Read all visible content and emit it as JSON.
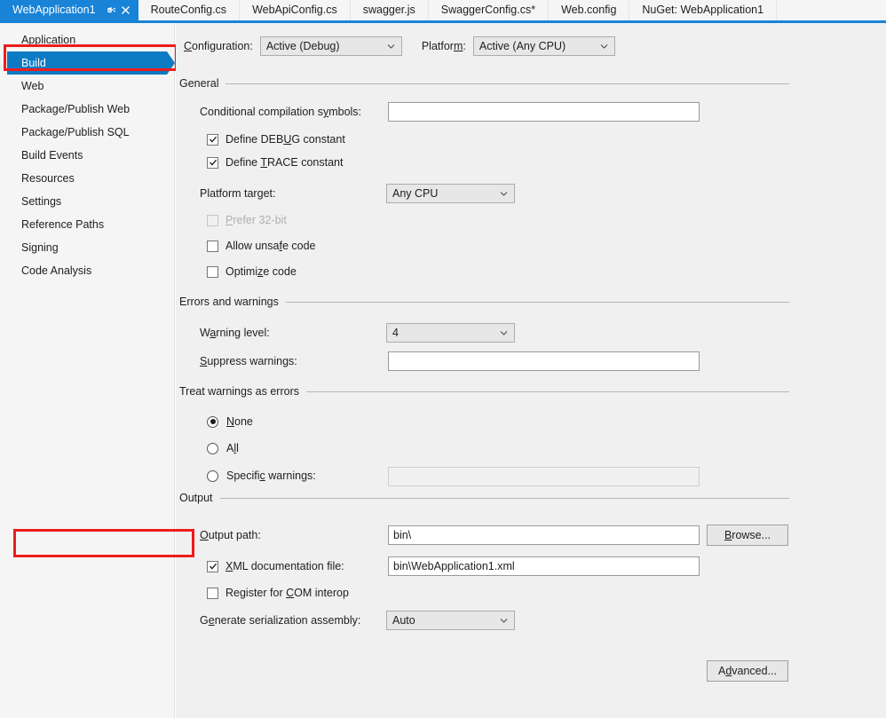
{
  "tabs": [
    {
      "label": "WebApplication1",
      "active": true,
      "pin_icon": "pin-icon",
      "close_icon": "close-icon"
    },
    {
      "label": "RouteConfig.cs",
      "active": false
    },
    {
      "label": "WebApiConfig.cs",
      "active": false
    },
    {
      "label": "swagger.js",
      "active": false
    },
    {
      "label": "SwaggerConfig.cs*",
      "active": false
    },
    {
      "label": "Web.config",
      "active": false
    },
    {
      "label": "NuGet: WebApplication1",
      "active": false
    }
  ],
  "sidebar": {
    "items": [
      {
        "label": "Application",
        "selected": false
      },
      {
        "label": "Build",
        "selected": true
      },
      {
        "label": "Web",
        "selected": false
      },
      {
        "label": "Package/Publish Web",
        "selected": false
      },
      {
        "label": "Package/Publish SQL",
        "selected": false
      },
      {
        "label": "Build Events",
        "selected": false
      },
      {
        "label": "Resources",
        "selected": false
      },
      {
        "label": "Settings",
        "selected": false
      },
      {
        "label": "Reference Paths",
        "selected": false
      },
      {
        "label": "Signing",
        "selected": false
      },
      {
        "label": "Code Analysis",
        "selected": false
      }
    ]
  },
  "config_row": {
    "configuration_label_pre": "C",
    "configuration_label_post": "onfiguration:",
    "configuration_value": "Active (Debug)",
    "platform_label_pre": "Platfor",
    "platform_label_mn": "m",
    "platform_label_post": ":",
    "platform_value": "Active (Any CPU)"
  },
  "general": {
    "title": "General",
    "cond_symbols_label_pre": "Conditional compilation s",
    "cond_symbols_label_mn": "y",
    "cond_symbols_label_post": "mbols:",
    "cond_symbols_value": "",
    "define_debug_pre": "Define DEB",
    "define_debug_mn": "U",
    "define_debug_post": "G constant",
    "define_debug_checked": true,
    "define_trace_pre": "Define ",
    "define_trace_mn": "T",
    "define_trace_post": "RACE constant",
    "define_trace_checked": true,
    "platform_target_label_pre": "Platform tar",
    "platform_target_label_mn": "g",
    "platform_target_label_post": "et:",
    "platform_target_value": "Any CPU",
    "prefer32_pre": "",
    "prefer32_mn": "P",
    "prefer32_post": "refer 32-bit",
    "prefer32_checked": false,
    "prefer32_disabled": true,
    "unsafe_pre": "Allow unsa",
    "unsafe_mn": "f",
    "unsafe_post": "e code",
    "unsafe_checked": false,
    "optimize_pre": "Optimi",
    "optimize_mn": "z",
    "optimize_post": "e code",
    "optimize_checked": false
  },
  "errors_warnings": {
    "title": "Errors and warnings",
    "warning_level_label_pre": "W",
    "warning_level_label_mn": "a",
    "warning_level_label_post": "rning level:",
    "warning_level_value": "4",
    "suppress_label_pre": "",
    "suppress_label_mn": "S",
    "suppress_label_post": "uppress warnings:",
    "suppress_value": ""
  },
  "treat_warnings": {
    "title": "Treat warnings as errors",
    "none_pre": "",
    "none_mn": "N",
    "none_post": "one",
    "all_pre": "A",
    "all_mn": "l",
    "all_post": "l",
    "specific_pre": "Specifi",
    "specific_mn": "c",
    "specific_post": " warnings:",
    "selected": "None",
    "specific_value": ""
  },
  "output": {
    "title": "Output",
    "output_path_label_pre": "",
    "output_path_label_mn": "O",
    "output_path_label_post": "utput path:",
    "output_path_value": "bin\\",
    "browse_pre": "",
    "browse_mn": "B",
    "browse_post": "rowse...",
    "xml_doc_pre": "",
    "xml_doc_mn": "X",
    "xml_doc_post": "ML documentation file:",
    "xml_doc_checked": true,
    "xml_doc_value": "bin\\WebApplication1.xml",
    "register_com_pre": "Register for ",
    "register_com_mn": "C",
    "register_com_post": "OM interop",
    "register_com_checked": false,
    "serialization_label_pre": "G",
    "serialization_label_mn": "e",
    "serialization_label_post": "nerate serialization assembly:",
    "serialization_value": "Auto"
  },
  "footer": {
    "advanced_pre": "A",
    "advanced_mn": "d",
    "advanced_post": "vanced..."
  },
  "colors": {
    "accent_blue": "#1883d7",
    "nav_selected_blue": "#0d7bc4",
    "annotation_red": "#ee1c1c",
    "panel_bg": "#f0f0f0",
    "sidebar_bg": "#f5f5f5"
  }
}
